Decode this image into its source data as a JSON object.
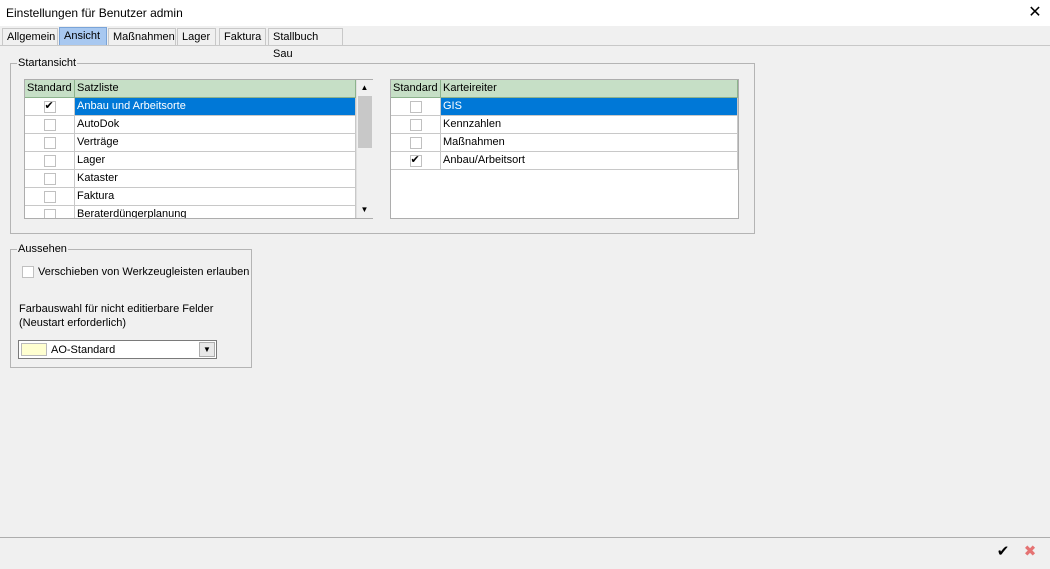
{
  "window": {
    "title": "Einstellungen für Benutzer admin"
  },
  "tabs": [
    {
      "label": "Allgemein"
    },
    {
      "label": "Ansicht"
    },
    {
      "label": "Maßnahmen"
    },
    {
      "label": "Lager"
    },
    {
      "label": "Faktura"
    },
    {
      "label": "Stallbuch Sau"
    }
  ],
  "active_tab": "Ansicht",
  "startansicht": {
    "label": "Startansicht",
    "satzliste": {
      "col_standard": "Standard",
      "col_name": "Satzliste",
      "rows": [
        {
          "name": "Anbau und Arbeitsorte",
          "checked": true,
          "selected": true
        },
        {
          "name": "AutoDok",
          "checked": false
        },
        {
          "name": "Verträge",
          "checked": false
        },
        {
          "name": "Lager",
          "checked": false
        },
        {
          "name": "Kataster",
          "checked": false
        },
        {
          "name": "Faktura",
          "checked": false
        },
        {
          "name": "Beraterdüngerplanung",
          "checked": false
        }
      ]
    },
    "karteireiter": {
      "col_standard": "Standard",
      "col_name": "Karteireiter",
      "rows": [
        {
          "name": "GIS",
          "checked": false,
          "selected": true
        },
        {
          "name": "Kennzahlen",
          "checked": false
        },
        {
          "name": "Maßnahmen",
          "checked": false
        },
        {
          "name": "Anbau/Arbeitsort",
          "checked": true
        }
      ]
    }
  },
  "aussehen": {
    "label": "Aussehen",
    "toolbar_checkbox_label": "Verschieben von Werkzeugleisten erlauben",
    "color_label_line1": "Farbauswahl für nicht editierbare Felder",
    "color_label_line2": "(Neustart erforderlich)",
    "color_value": "AO-Standard",
    "swatch_color": "#ffffd0"
  },
  "colors": {
    "accent": "#0078d7",
    "grid_header": "#c6dfc6",
    "cancel": "#e57373"
  }
}
